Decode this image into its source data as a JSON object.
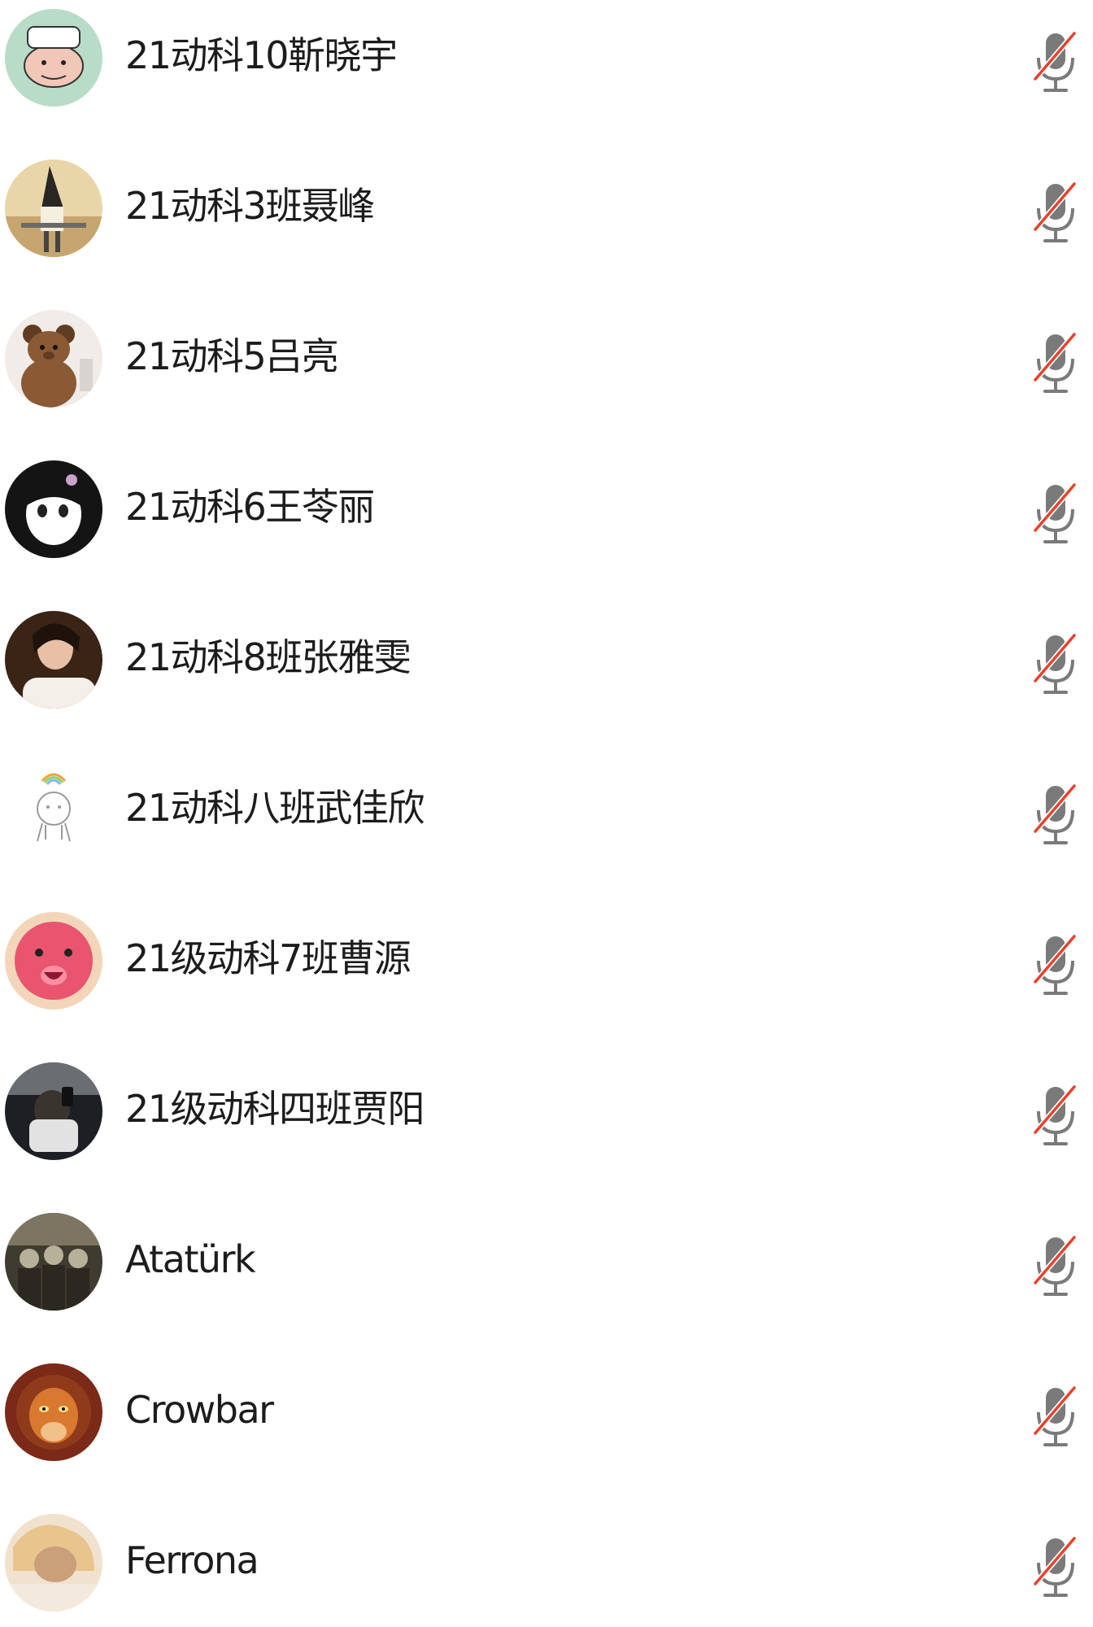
{
  "participants": [
    {
      "name": "21动科10靳晓宇",
      "avatar": "cartoon-character-avatar",
      "mic_icon": "microphone-muted-icon",
      "avatar_colors": [
        "#b8dcc8",
        "#f1c7b8",
        "#ffffff"
      ]
    },
    {
      "name": "21动科3班聂峰",
      "avatar": "witch-figure-avatar",
      "mic_icon": "microphone-muted-icon",
      "avatar_colors": [
        "#c7a56e",
        "#2a2624",
        "#e9d6a8"
      ]
    },
    {
      "name": "21动科5吕亮",
      "avatar": "teddy-bear-avatar",
      "mic_icon": "microphone-muted-icon",
      "avatar_colors": [
        "#f1ece8",
        "#8a5a35",
        "#5f3c22"
      ]
    },
    {
      "name": "21动科6王苓丽",
      "avatar": "anime-girl-avatar",
      "mic_icon": "microphone-muted-icon",
      "avatar_colors": [
        "#141414",
        "#ffffff",
        "#c9a3c9"
      ]
    },
    {
      "name": "21动科8班张雅雯",
      "avatar": "portrait-photo-avatar",
      "mic_icon": "microphone-muted-icon",
      "avatar_colors": [
        "#3a2416",
        "#e8c0a6",
        "#f4efe8"
      ]
    },
    {
      "name": "21动科八班武佳欣",
      "avatar": "rainbow-doodle-avatar",
      "mic_icon": "microphone-muted-icon",
      "avatar_colors": [
        "#ffffff",
        "#9a9a9a",
        "#7fb7e6"
      ]
    },
    {
      "name": "21级动科7班曹源",
      "avatar": "pink-bear-avatar",
      "mic_icon": "microphone-muted-icon",
      "avatar_colors": [
        "#e9546e",
        "#ff8ea3",
        "#f3d6b9"
      ]
    },
    {
      "name": "21级动科四班贾阳",
      "avatar": "car-selfie-avatar",
      "mic_icon": "microphone-muted-icon",
      "avatar_colors": [
        "#1d1f22",
        "#6a6e72",
        "#e2e2e2"
      ]
    },
    {
      "name": "Atatürk",
      "avatar": "group-photo-avatar",
      "mic_icon": "microphone-muted-icon",
      "avatar_colors": [
        "#3e3b30",
        "#7d7561",
        "#b7b19a"
      ]
    },
    {
      "name": "Crowbar",
      "avatar": "lion-character-avatar",
      "mic_icon": "microphone-muted-icon",
      "avatar_colors": [
        "#7a2a16",
        "#d9782f",
        "#f2c08a"
      ]
    },
    {
      "name": "Ferrona",
      "avatar": "blonde-person-avatar",
      "mic_icon": "microphone-muted-icon",
      "avatar_colors": [
        "#f1e2cf",
        "#e9c58e",
        "#c9a07a"
      ]
    }
  ],
  "colors": {
    "mic_gray": "#7a7a7a",
    "mute_slash": "#e8412b",
    "text": "#1c1c1c"
  }
}
